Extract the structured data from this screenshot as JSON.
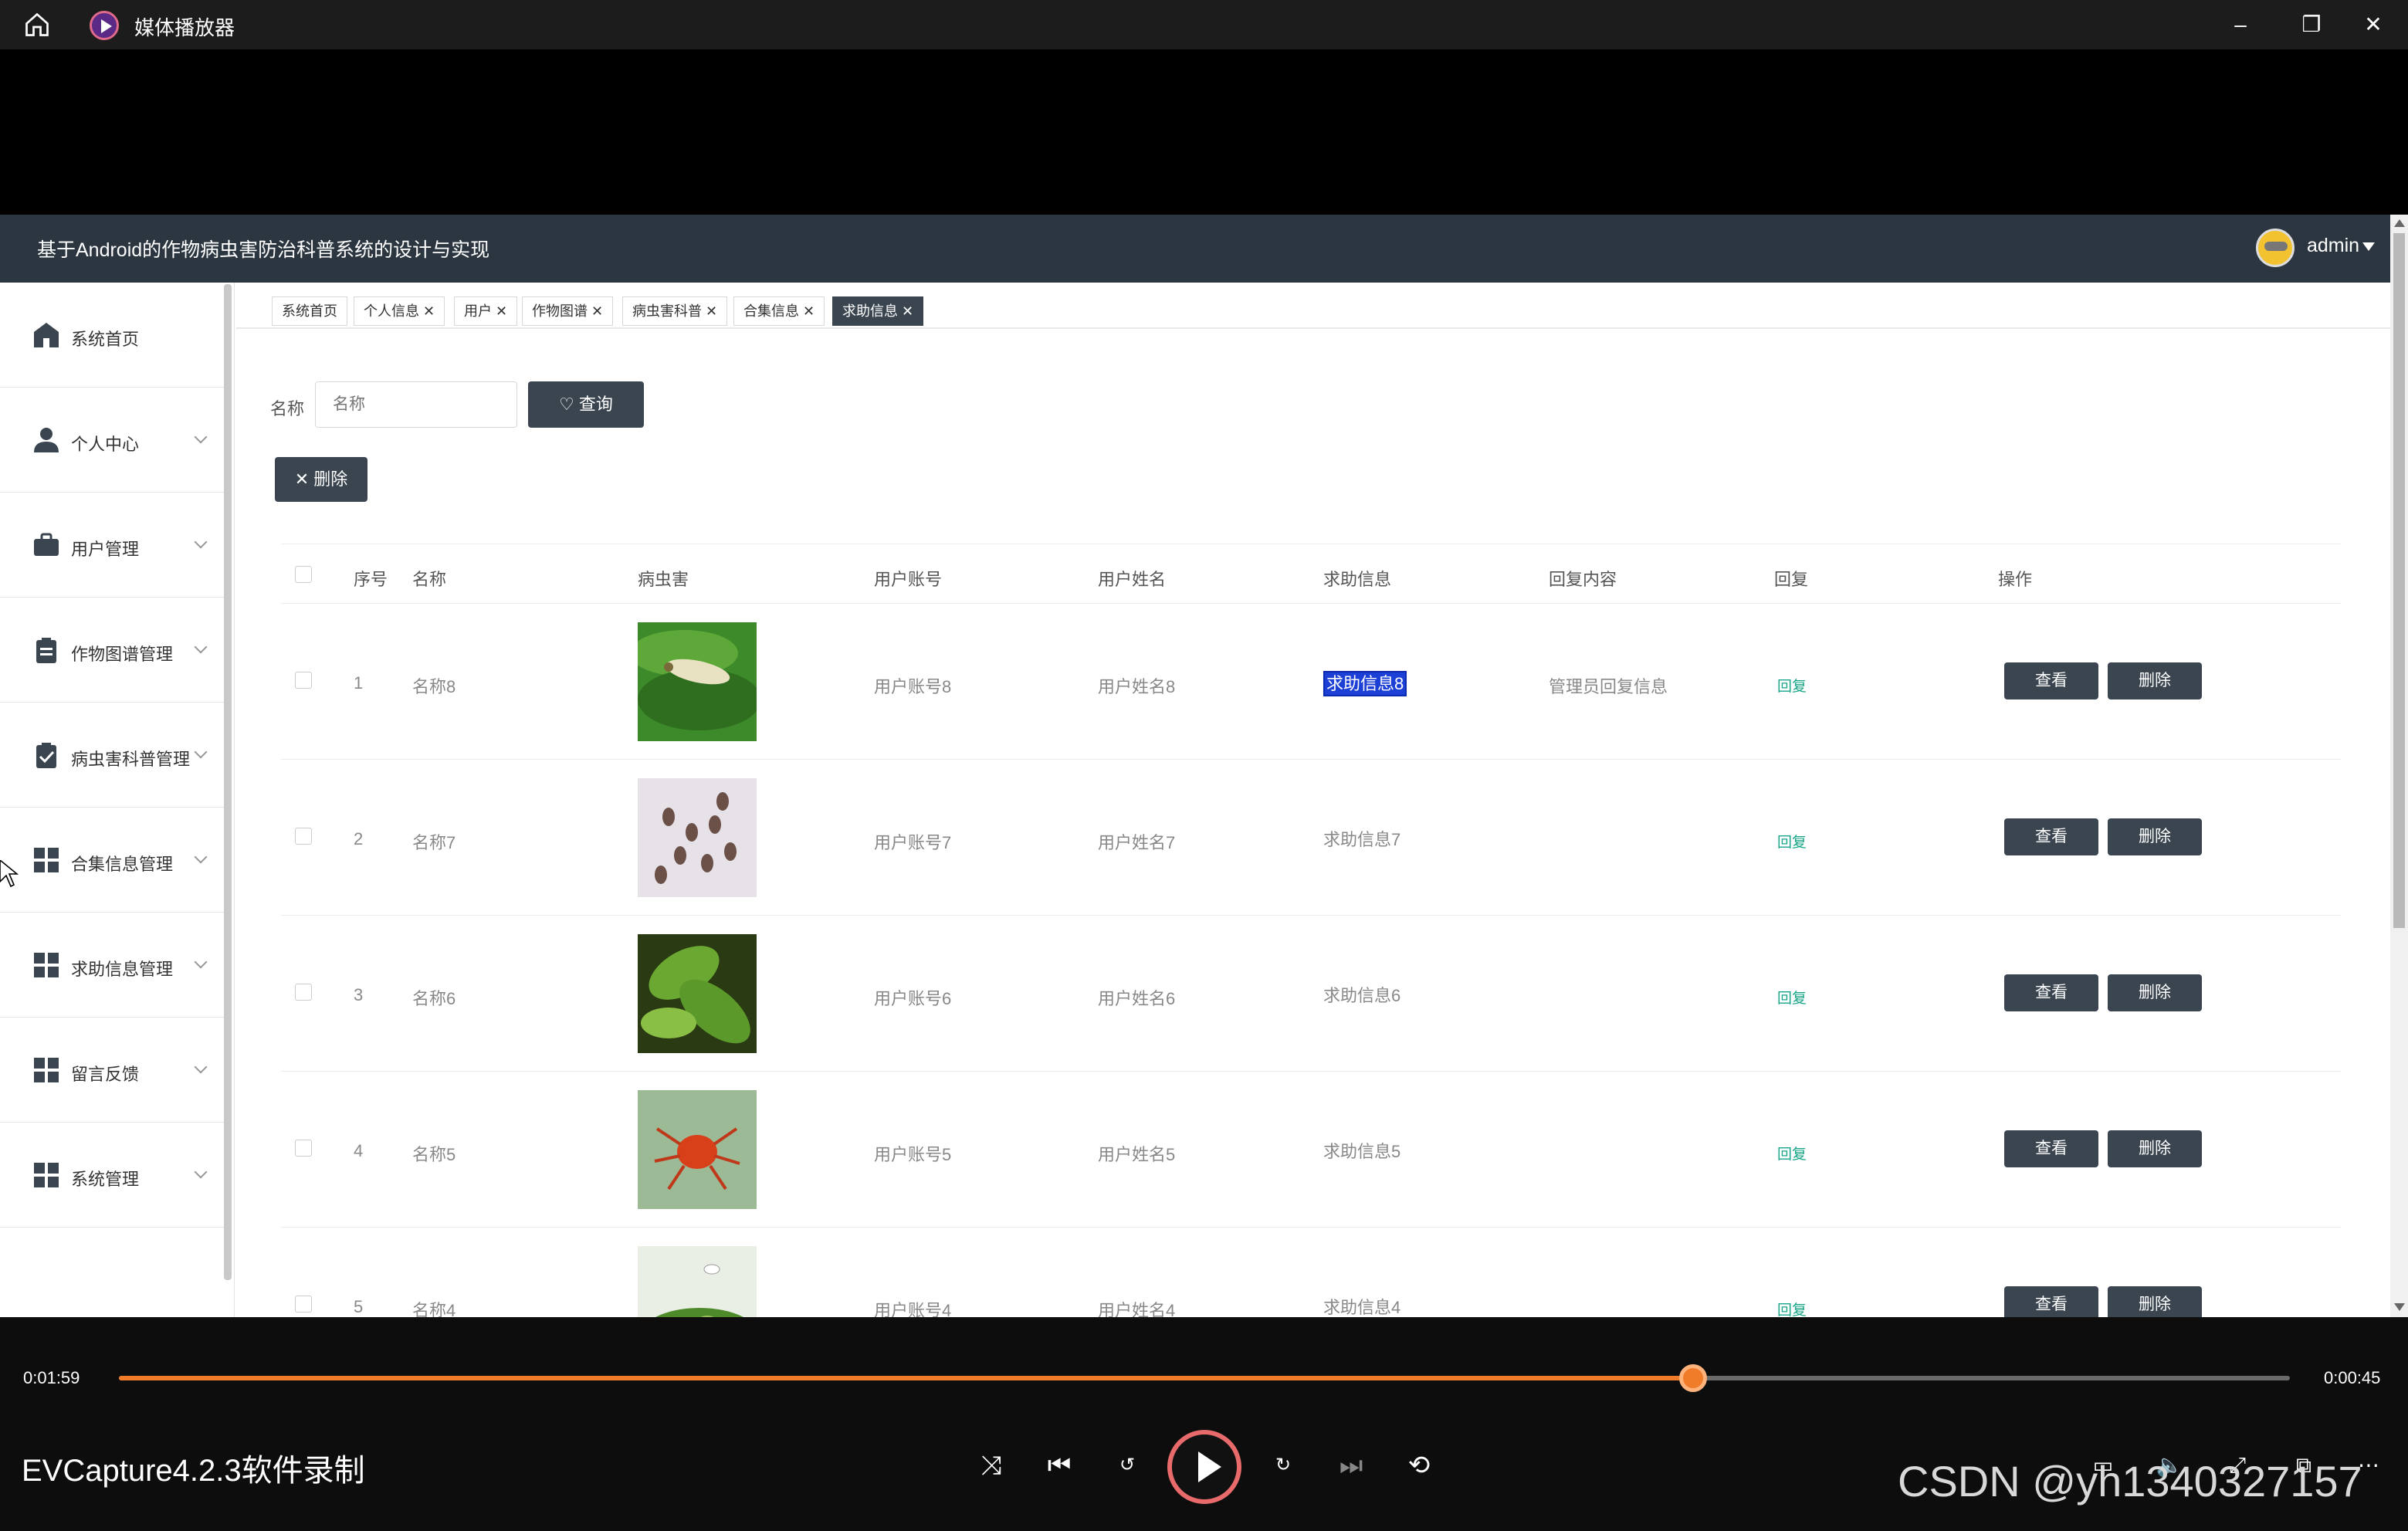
{
  "window": {
    "title": "媒体播放器",
    "icons": [
      "home-icon",
      "player-logo-icon",
      "minimize-icon",
      "restore-icon",
      "close-icon"
    ]
  },
  "app": {
    "title": "基于Android的作物病虫害防治科普系统的设计与实现",
    "user": "admin",
    "sidebar": [
      {
        "label": "系统首页",
        "icon": "home-icon"
      },
      {
        "label": "个人中心",
        "icon": "user-icon"
      },
      {
        "label": "用户管理",
        "icon": "briefcase-icon"
      },
      {
        "label": "作物图谱管理",
        "icon": "clipboard-icon"
      },
      {
        "label": "病虫害科普管理",
        "icon": "clipboard-check-icon"
      },
      {
        "label": "合集信息管理",
        "icon": "grid-icon"
      },
      {
        "label": "求助信息管理",
        "icon": "grid-icon"
      },
      {
        "label": "留言反馈",
        "icon": "grid-icon"
      },
      {
        "label": "系统管理",
        "icon": "grid-icon"
      }
    ],
    "tabs": [
      {
        "label": "系统首页",
        "closable": false
      },
      {
        "label": "个人信息",
        "closable": true
      },
      {
        "label": "用户",
        "closable": true
      },
      {
        "label": "作物图谱",
        "closable": true
      },
      {
        "label": "病虫害科普",
        "closable": true
      },
      {
        "label": "合集信息",
        "closable": true
      },
      {
        "label": "求助信息",
        "closable": true,
        "active": true
      }
    ],
    "search": {
      "label": "名称",
      "placeholder": "名称",
      "button": "查询"
    },
    "bulk_delete": "删除",
    "columns": [
      "序号",
      "名称",
      "病虫害",
      "用户账号",
      "用户姓名",
      "求助信息",
      "回复内容",
      "回复",
      "操作"
    ],
    "rows": [
      {
        "idx": "1",
        "name": "名称8",
        "account": "用户账号8",
        "username": "用户姓名8",
        "help": "求助信息8",
        "reply_content": "管理员回复信息",
        "reply": "回复",
        "view": "查看",
        "delete": "删除",
        "img": "larva",
        "selected": true
      },
      {
        "idx": "2",
        "name": "名称7",
        "account": "用户账号7",
        "username": "用户姓名7",
        "help": "求助信息7",
        "reply_content": "",
        "reply": "回复",
        "view": "查看",
        "delete": "删除",
        "img": "aphids"
      },
      {
        "idx": "3",
        "name": "名称6",
        "account": "用户账号6",
        "username": "用户姓名6",
        "help": "求助信息6",
        "reply_content": "",
        "reply": "回复",
        "view": "查看",
        "delete": "删除",
        "img": "leaves"
      },
      {
        "idx": "4",
        "name": "名称5",
        "account": "用户账号5",
        "username": "用户姓名5",
        "help": "求助信息5",
        "reply_content": "",
        "reply": "回复",
        "view": "查看",
        "delete": "删除",
        "img": "mite"
      },
      {
        "idx": "5",
        "name": "名称4",
        "account": "用户账号4",
        "username": "用户姓名4",
        "help": "求助信息4",
        "reply_content": "",
        "reply": "回复",
        "view": "查看",
        "delete": "删除",
        "img": "whitefly"
      }
    ]
  },
  "player": {
    "elapsed": "0:01:59",
    "remaining": "0:00:45",
    "progress": 0.725,
    "caption": "EVCapture4.2.3软件录制",
    "watermark": "CSDN @yh1340327157",
    "accent": "#f07c2a"
  }
}
